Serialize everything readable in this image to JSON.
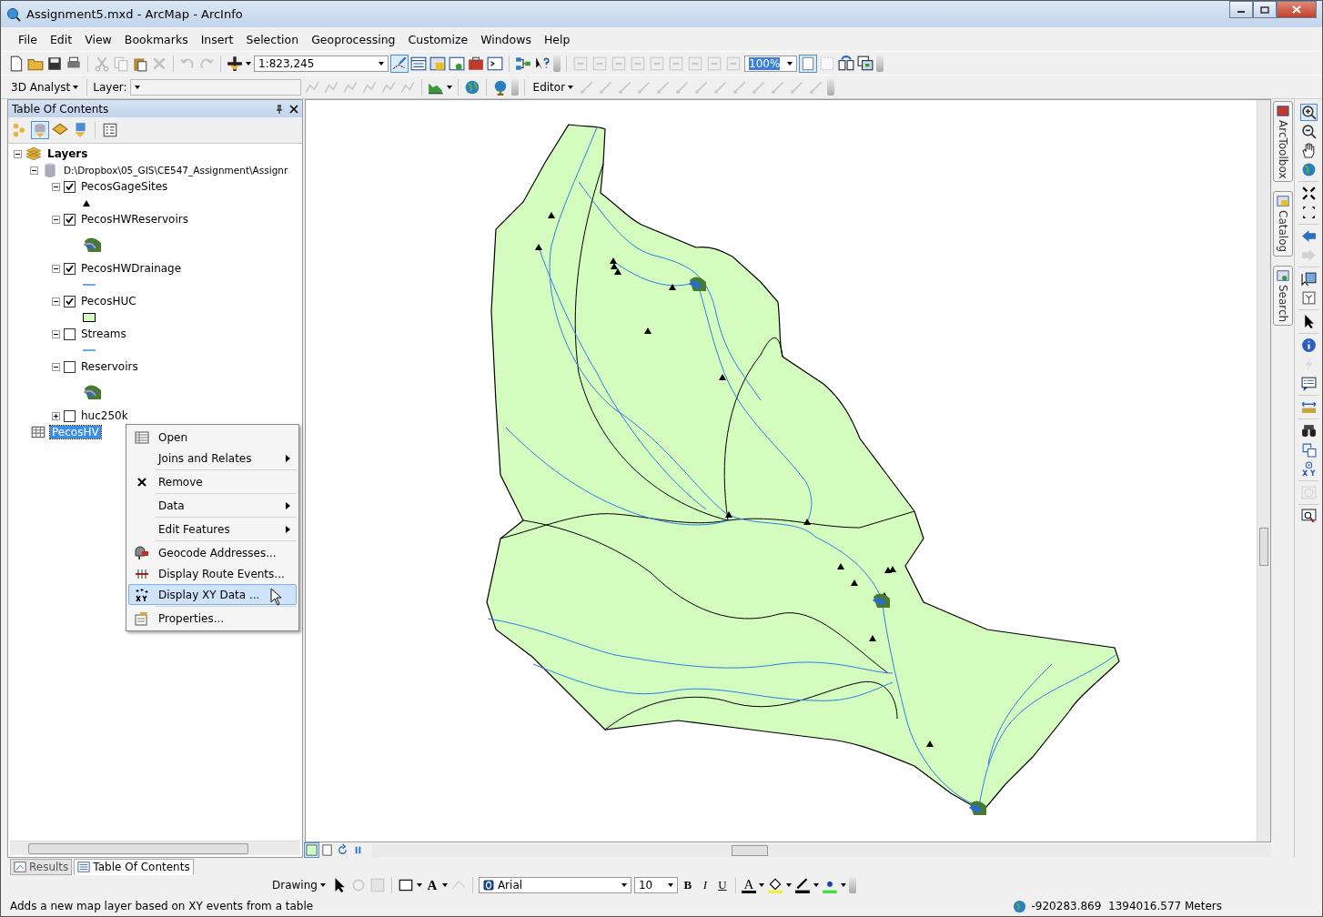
{
  "window": {
    "title": "Assignment5.mxd - ArcMap - ArcInfo"
  },
  "menu": [
    "File",
    "Edit",
    "View",
    "Bookmarks",
    "Insert",
    "Selection",
    "Geoprocessing",
    "Customize",
    "Windows",
    "Help"
  ],
  "standard_toolbar": {
    "scale": "1:823,245"
  },
  "layout_toolbar": {
    "zoom": "100%"
  },
  "analyst_toolbar": {
    "dropdown": "3D Analyst",
    "layer_label": "Layer:"
  },
  "editor_toolbar": {
    "dropdown": "Editor"
  },
  "toc": {
    "title": "Table Of Contents",
    "tree": [
      {
        "label": "Layers",
        "expanded": true,
        "children": [
          {
            "label": "D:\\Dropbox\\05_GIS\\CE547_Assignment\\Assignr",
            "expanded": true,
            "children": [
              {
                "label": "PecosGageSites",
                "checked": true,
                "expanded": true,
                "kind": "point"
              },
              {
                "label": "PecosHWReservoirs",
                "checked": true,
                "expanded": true,
                "kind": "reservoir"
              },
              {
                "label": "PecosHWDrainage",
                "checked": true,
                "expanded": true,
                "kind": "line"
              },
              {
                "label": "PecosHUC",
                "checked": true,
                "expanded": true,
                "kind": "polygon"
              },
              {
                "label": "Streams",
                "checked": false,
                "expanded": true,
                "kind": "line"
              },
              {
                "label": "Reservoirs",
                "checked": false,
                "expanded": true,
                "kind": "reservoir"
              },
              {
                "label": "huc250k",
                "checked": false,
                "expanded": false
              }
            ]
          },
          {
            "label": "PecosHV",
            "kind": "table",
            "selected": true
          }
        ]
      }
    ]
  },
  "context_menu": [
    {
      "label": "Open",
      "kind": "table",
      "submenu": false,
      "selected": false
    },
    {
      "label": "Joins and Relates",
      "kind": "plain",
      "submenu": true,
      "selected": false
    },
    {
      "label": "Remove",
      "kind": "remove",
      "submenu": false,
      "selected": false
    },
    {
      "label": "Data",
      "kind": "plain",
      "submenu": true,
      "selected": false
    },
    {
      "label": "Edit Features",
      "kind": "plain",
      "submenu": true,
      "selected": false
    },
    {
      "label": "Geocode Addresses...",
      "kind": "geocode",
      "submenu": false,
      "selected": false
    },
    {
      "label": "Display Route Events...",
      "kind": "route",
      "submenu": false,
      "selected": false
    },
    {
      "label": "Display XY Data ...",
      "kind": "xy",
      "submenu": false,
      "selected": true
    },
    {
      "label": "Properties...",
      "kind": "properties",
      "submenu": false,
      "selected": false
    }
  ],
  "dock_tabs": [
    "ArcToolbox",
    "Catalog",
    "Search"
  ],
  "bottom_tabs": [
    {
      "label": "Results",
      "selected": false
    },
    {
      "label": "Table Of Contents",
      "selected": true
    }
  ],
  "drawing_toolbar": {
    "dropdown": "Drawing",
    "text_tool": "A",
    "font": "Arial",
    "size": "10",
    "bold": "B",
    "italic": "I",
    "underline": "U",
    "font_color": "A"
  },
  "status_bar": {
    "message": "Adds a new map layer based on XY events from a table",
    "coordinates": "-920283.869  1394016.577 Meters"
  }
}
